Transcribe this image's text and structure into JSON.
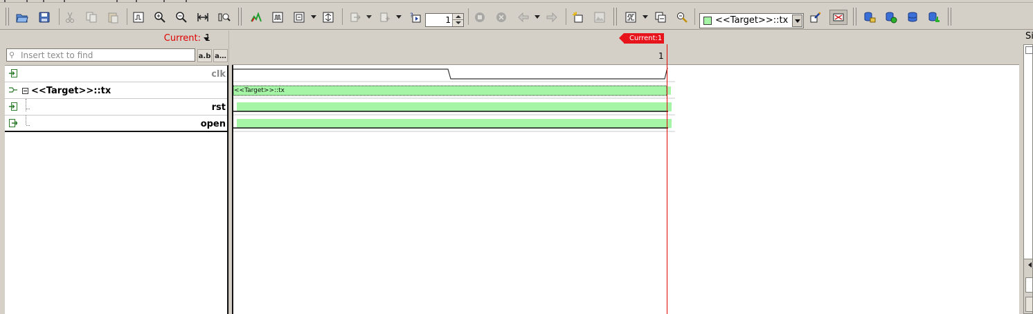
{
  "toolbar": {
    "step_value": "1",
    "target_selector": {
      "label": "<<Target>>::tx",
      "swatch_color": "#a6f5a6"
    },
    "icons": [
      "open-icon",
      "save-icon",
      "cut-icon",
      "copy-icon",
      "paste-icon",
      "zoom-fit-icon",
      "zoom-in-icon",
      "zoom-out-icon",
      "zoom-range-icon",
      "zoom-find-icon",
      "add-signal-icon",
      "bus-icon",
      "group-icon",
      "expand-icon",
      "sample-icon",
      "sample-add-icon",
      "run-step-icon",
      "stop-icon",
      "cancel-icon",
      "back-arrow-icon",
      "forward-arrow-icon",
      "new-marker-icon",
      "image-icon",
      "compare-icon",
      "layout-icon",
      "inspect-icon",
      "highlight-icon",
      "filter-icon",
      "db-connect-icon",
      "db-trigger-icon",
      "db-load-icon",
      "db-stats-icon"
    ]
  },
  "left_panel": {
    "current_label": "Current:",
    "current_value": "1",
    "search_placeholder": "Insert text to find",
    "match_case_label": "a.b",
    "match_all_label": "a…"
  },
  "signals": [
    {
      "name": "clk",
      "kind": "input",
      "greyed": true
    },
    {
      "name": "<<Target>>::tx",
      "kind": "group",
      "greyed": false
    },
    {
      "name": "rst",
      "kind": "input",
      "greyed": false
    },
    {
      "name": "open",
      "kind": "output",
      "greyed": false
    }
  ],
  "wave": {
    "cursor_label": "Current:1",
    "tick_label": "1",
    "bus_value_label": "<<Target>>::tx",
    "wave_color": "#a6f5a6",
    "cursor_color": "#e00000"
  },
  "right_dock": {
    "title": "Si"
  }
}
